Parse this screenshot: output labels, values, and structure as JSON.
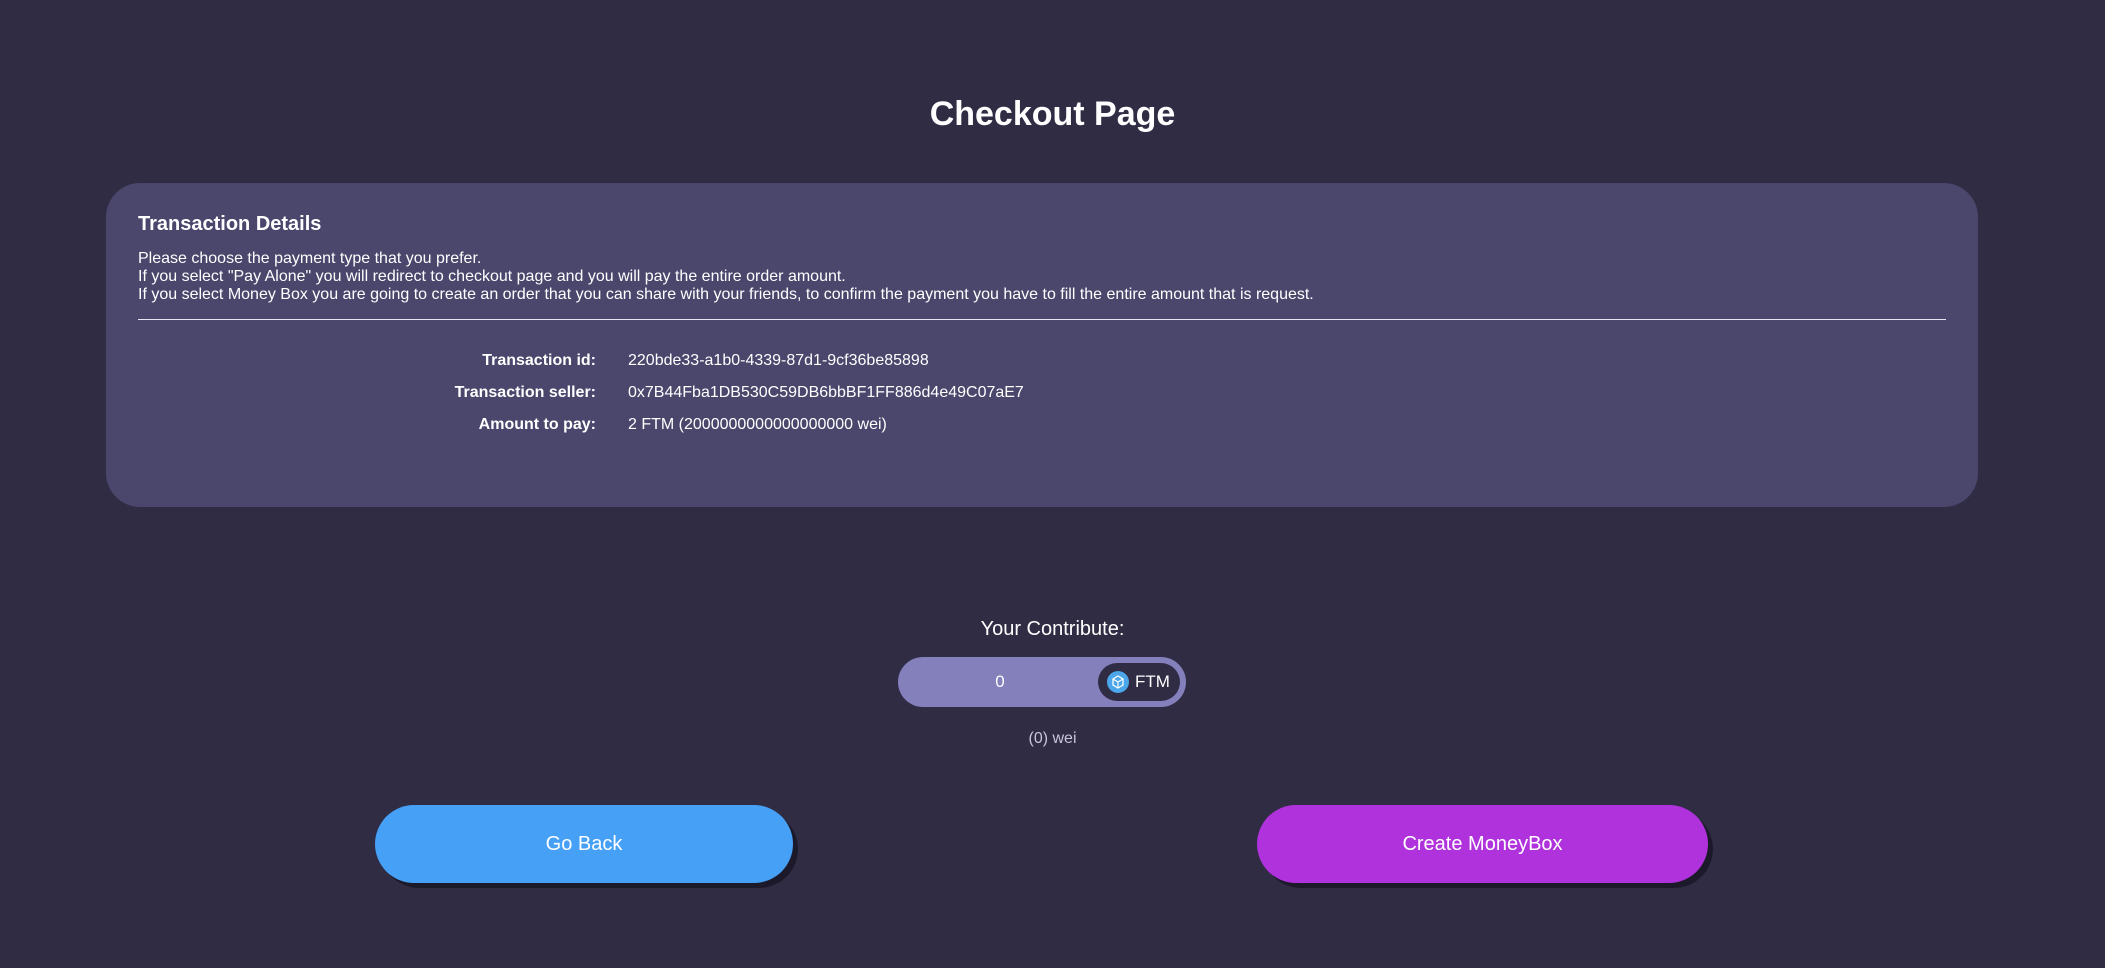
{
  "page": {
    "title": "Checkout Page"
  },
  "transaction": {
    "heading": "Transaction Details",
    "description": [
      "Please choose the payment type that you prefer.",
      "If you select \"Pay Alone\" you will redirect to checkout page and you will pay the entire order amount.",
      "If you select Money Box you are going to create an order that you can share with your friends, to confirm the payment you have to fill the entire amount that is request."
    ],
    "rows": [
      {
        "label": "Transaction id:",
        "value": "220bde33-a1b0-4339-87d1-9cf36be85898"
      },
      {
        "label": "Transaction seller:",
        "value": "0x7B44Fba1DB530C59DB6bbBF1FF886d4e49C07aE7"
      },
      {
        "label": "Amount to pay:",
        "value": "2 FTM (2000000000000000000 wei)"
      }
    ]
  },
  "contribute": {
    "label": "Your Contribute:",
    "input_value": "0",
    "token": "FTM",
    "token_icon": "fantom-token-icon",
    "wei_text": "(0) wei"
  },
  "actions": {
    "back_label": "Go Back",
    "create_label": "Create MoneyBox"
  },
  "colors": {
    "background": "#2f2c44",
    "card": "#4a466c",
    "input": "#8480bc",
    "back_button": "#45a0f6",
    "create_button": "#af32dc"
  }
}
